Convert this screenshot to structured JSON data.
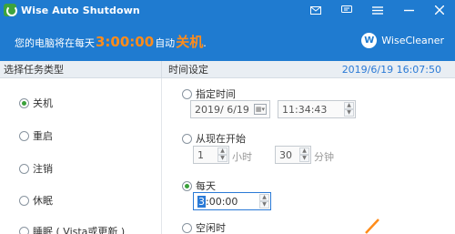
{
  "window": {
    "title": "Wise Auto Shutdown"
  },
  "banner": {
    "prefix": "您的电脑将在每天",
    "time": "3:00:00",
    "middle": "自动",
    "action": "关机",
    "suffix": ".",
    "brand": "WiseCleaner",
    "brand_logo_letter": "W"
  },
  "left": {
    "header": "选择任务类型",
    "tasks": [
      {
        "label": "关机",
        "selected": true
      },
      {
        "label": "重启",
        "selected": false
      },
      {
        "label": "注销",
        "selected": false
      },
      {
        "label": "休眠",
        "selected": false
      },
      {
        "label": "睡眠 ( Vista或更新 )",
        "selected": false
      }
    ]
  },
  "right": {
    "header": "时间设定",
    "datetime": "2019/6/19 16:07:50",
    "specified": {
      "label": "指定时间",
      "date_value": "2019/  6/19",
      "time_value": "11:34:43"
    },
    "from_now": {
      "label": "从现在开始",
      "hours_value": "1",
      "hours_unit": "小时",
      "minutes_value": "30",
      "minutes_unit": "分钟"
    },
    "daily": {
      "label": "每天",
      "time_value_sel": "3",
      "time_value_rest": ":00:00"
    },
    "idle": {
      "label": "空闲时"
    }
  },
  "colors": {
    "accent": "#1f7bd0",
    "highlight": "#ff8c1a",
    "radio_on": "#3aa13a",
    "date_text": "#2a7ad6"
  }
}
